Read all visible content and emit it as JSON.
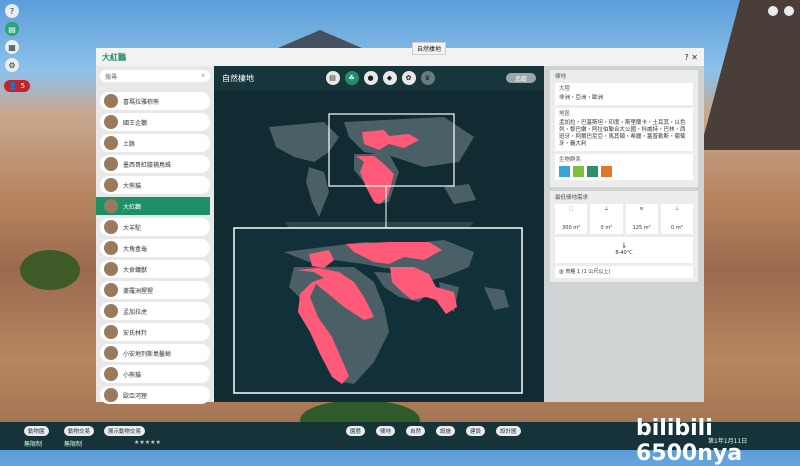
{
  "window_title": "大紅鸛",
  "tab_tooltip": "自然棲地",
  "search_placeholder": "搜尋",
  "main_heading": "自然棲地",
  "follow_label": "追蹤",
  "help_label": "?",
  "close_label": "✕",
  "left_badge_count": "5",
  "species": [
    {
      "name": "喜瑪拉雅棕熊",
      "selected": false
    },
    {
      "name": "國王企鵝",
      "selected": false
    },
    {
      "name": "土豚",
      "selected": false
    },
    {
      "name": "墨西哥紅膝捕鳥蛛",
      "selected": false
    },
    {
      "name": "大熊貓",
      "selected": false
    },
    {
      "name": "大紅鸛",
      "selected": true
    },
    {
      "name": "大羊駝",
      "selected": false
    },
    {
      "name": "大角盒龜",
      "selected": false
    },
    {
      "name": "大食蟻獸",
      "selected": false
    },
    {
      "name": "婆羅洲猩猩",
      "selected": false
    },
    {
      "name": "孟加拉虎",
      "selected": false
    },
    {
      "name": "安氏林羚",
      "selected": false
    },
    {
      "name": "小安地列斯島鬣蜥",
      "selected": false
    },
    {
      "name": "小熊貓",
      "selected": false
    },
    {
      "name": "歐亞河狸",
      "selected": false
    }
  ],
  "tab_icons": [
    "document-icon",
    "habitat-icon",
    "food-icon",
    "enrichment-icon",
    "paw-icon",
    "trophy-icon"
  ],
  "habitat": {
    "section_title": "棲地",
    "continent_label": "大陸",
    "continent_value": "非洲・亞洲・歐洲",
    "region_label": "地區",
    "region_value": "孟加拉・巴基斯坦・印度・斯里蘭卡・土耳其・以色列・黎巴嫩・阿拉伯聯合大公國・科威特・巴林・西班牙・阿爾巴尼亞・馬其頓・希臘・塞普勒斯・葡萄牙・義大利",
    "biome_label": "生物群系",
    "biomes": [
      "#3aa6d0",
      "#7fbf3a",
      "#2f8f6a",
      "#e07a2a"
    ]
  },
  "requirements": {
    "title": "最低棲地需求",
    "items": [
      {
        "icon": "land-area-icon",
        "value": "300 m²"
      },
      {
        "icon": "climbing-icon",
        "value": "0 m²"
      },
      {
        "icon": "water-area-icon",
        "value": "125 m²"
      },
      {
        "icon": "deep-water-icon",
        "value": "0 m²"
      }
    ],
    "temperature": "8-40°C",
    "shelter": "育種 1 (1 公尺以上)"
  },
  "bottom": {
    "left_buttons": [
      "動物園",
      "動物交易",
      "展示動物交易"
    ],
    "status_left": "無限制",
    "status_mid": "無限制",
    "center_buttons": [
      "園藝",
      "棲地",
      "自然",
      "設施",
      "建設",
      "設計圖"
    ],
    "date": "第1年1月11日",
    "watermark": "bilibili 6500nya"
  },
  "colors": {
    "accent": "#1f8f68",
    "range": "#ff5a77",
    "ocean": "#0f2a30",
    "land": "#4b5f66"
  }
}
